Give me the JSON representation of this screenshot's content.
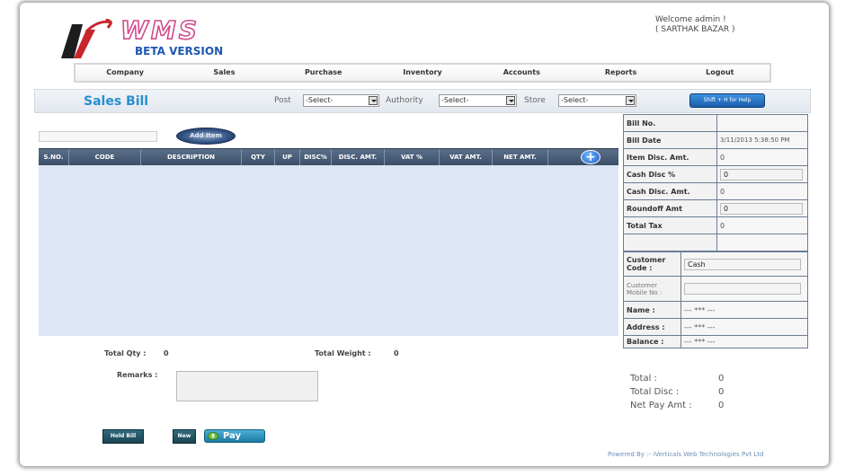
{
  "brand": {
    "name": "WMS",
    "subtitle": "BETA VERSION",
    "accent": "#d14b8c",
    "subtitle_color": "#1f57b0"
  },
  "welcome": {
    "line1": "Welcome admin !",
    "line2": "( SARTHAK BAZAR )"
  },
  "nav": [
    "Company",
    "Sales",
    "Purchase",
    "Inventory",
    "Accounts",
    "Reports",
    "Logout"
  ],
  "toolbar": {
    "title": "Sales Bill",
    "post_label": "Post",
    "post_value": "-Select-",
    "authority_label": "Authority",
    "authority_value": "-Select-",
    "store_label": "Store",
    "store_value": "-Select-",
    "help_label": "Shift + H for Help"
  },
  "items": {
    "go_label": "Add Item",
    "columns": [
      "S.NO.",
      "CODE",
      "DESCRIPTION",
      "QTY",
      "UP",
      "DISC%",
      "DISC. AMT.",
      "VAT %",
      "VAT AMT.",
      "NET AMT."
    ],
    "add_icon": "plus-circle-icon"
  },
  "bill": {
    "bill_no_label": "Bill No.",
    "bill_no_value": "",
    "bill_date_label": "Bill Date",
    "bill_date_value": "3/11/2013 5:38:50 PM",
    "item_disc_label": "Item Disc. Amt.",
    "item_disc_value": "0",
    "cash_disc_pct_label": "Cash Disc %",
    "cash_disc_pct_value": "0",
    "cash_disc_amt_label": "Cash Disc. Amt.",
    "cash_disc_amt_value": "0",
    "roundoff_label": "Roundoff Amt",
    "roundoff_value": "0",
    "total_tax_label": "Total Tax",
    "total_tax_value": "0"
  },
  "customer": {
    "code_label": "Customer Code :",
    "code_value": "Cash",
    "mobile_label": "Customer Mobile No :",
    "mobile_value": "",
    "name_label": "Name :",
    "name_value": "--- *** ---",
    "address_label": "Address :",
    "address_value": "--- *** ---",
    "balance_label": "Balance :",
    "balance_value": "--- *** ---"
  },
  "footer": {
    "total_qty_label": "Total Qty :",
    "total_qty_value": "0",
    "total_weight_label": "Total Weight :",
    "total_weight_value": "0",
    "remarks_label": "Remarks :",
    "total_label": "Total :",
    "total_value": "0",
    "total_disc_label": "Total Disc :",
    "total_disc_value": "0",
    "net_pay_label": "Net Pay Amt :",
    "net_pay_value": "0",
    "hold_label": "Hold Bill",
    "new_label": "New",
    "pay_label": "Pay",
    "pay_icon": "$",
    "powered": "Powered By :- iVerticals Web Technologies Pvt Ltd"
  }
}
